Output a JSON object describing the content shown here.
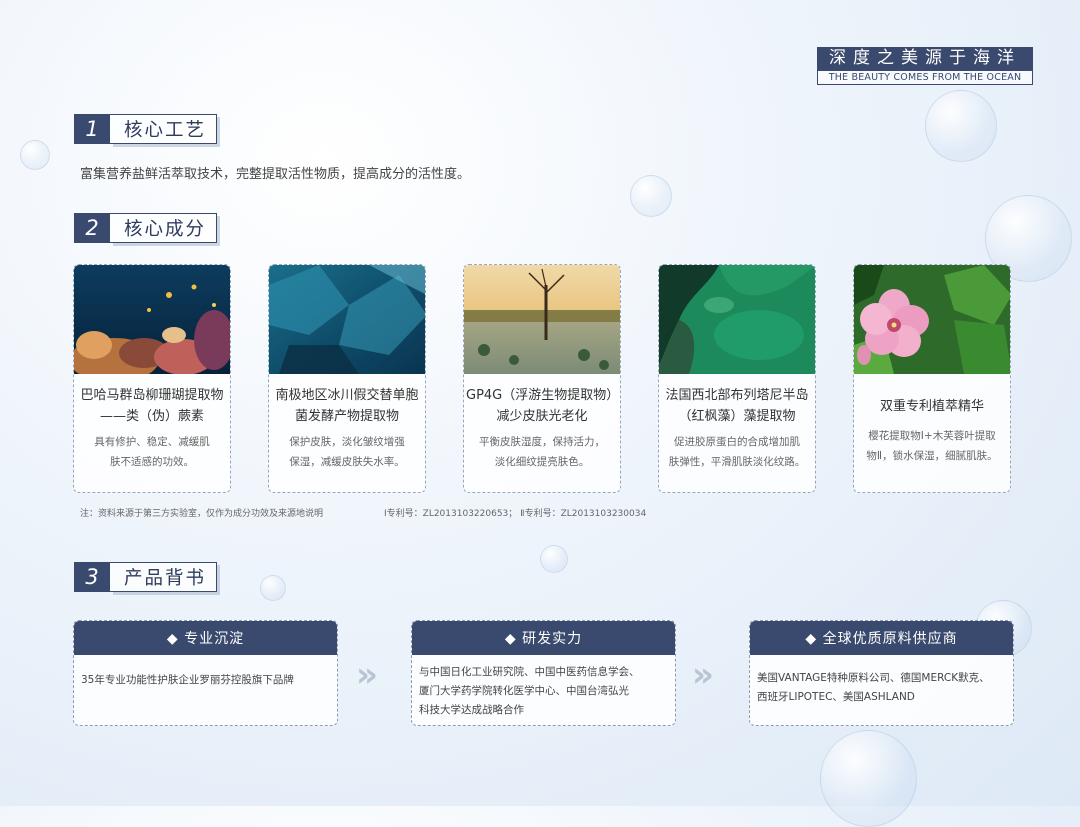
{
  "brand": {
    "title_cn": "深度之美源于海洋",
    "title_en": "THE BEAUTY COMES FROM THE OCEAN"
  },
  "sections": [
    {
      "number": "1",
      "title": "核心工艺"
    },
    {
      "number": "2",
      "title": "核心成分"
    },
    {
      "number": "3",
      "title": "产品背书"
    }
  ],
  "craft_text": "富集营养盐鲜活萃取技术，完整提取活性物质，提高成分的活性度。",
  "ingredients": [
    {
      "name_line1": "巴哈马群岛柳珊瑚提取物",
      "name_line2": "——类（伪）蕨素",
      "desc_line1": "具有修护、稳定、减缓肌",
      "desc_line2": "肤不适感的功效。"
    },
    {
      "name_line1": "南极地区冰川假交替单胞",
      "name_line2": "菌发酵产物提取物",
      "desc_line1": "保护皮肤，淡化皱纹增强",
      "desc_line2": "保湿，减缓皮肤失水率。"
    },
    {
      "name_line1": "GP4G（浮游生物提取物）",
      "name_line2": "减少皮肤光老化",
      "desc_line1": "平衡皮肤湿度，保持活力，",
      "desc_line2": "淡化细纹提亮肤色。"
    },
    {
      "name_line1": "法国西北部布列塔尼半岛",
      "name_line2": "（红枫藻）藻提取物",
      "desc_line1": "促进胶原蛋白的合成增加肌",
      "desc_line2": "肤弹性，平滑肌肤淡化纹路。"
    },
    {
      "name_line1": "双重专利植萃精华",
      "name_line2": "",
      "desc_line1": "樱花提取物Ⅰ+木芙蓉叶提取",
      "desc_line2": "物Ⅱ，锁水保湿，细腻肌肤。"
    }
  ],
  "notes": {
    "source": "注：资料来源于第三方实验室，仅作为成分功效及来源地说明",
    "patents": "Ⅰ专利号：ZL2013103220653；  Ⅱ专利号：ZL2013103230034"
  },
  "endorsements": [
    {
      "title": "◆ 专业沉淀",
      "lines": [
        "35年专业功能性护肤企业罗丽芬控股旗下品牌"
      ]
    },
    {
      "title": "◆ 研发实力",
      "lines": [
        "与中国日化工业研究院、中国中医药信息学会、",
        "厦门大学药学院转化医学中心、中国台湾弘光",
        "科技大学达成战略合作"
      ]
    },
    {
      "title": "◆ 全球优质原料供应商",
      "lines": [
        "美国VANTAGE特种原料公司、德国MERCK默克、",
        "西班牙LIPOTEC、美国ASHLAND"
      ]
    }
  ],
  "arrow_glyph": "»",
  "colors": {
    "navy": "#3a4a6e"
  }
}
